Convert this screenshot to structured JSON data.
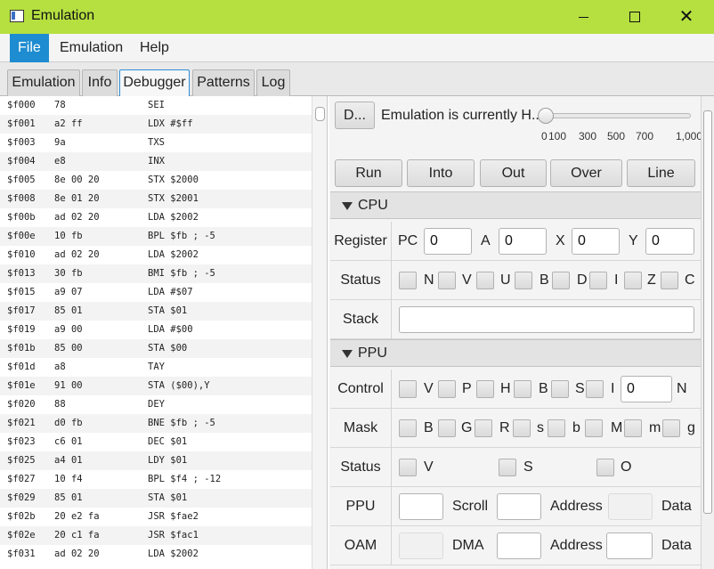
{
  "window": {
    "title": "Emulation"
  },
  "menu": {
    "items": [
      "File",
      "Emulation",
      "Help"
    ]
  },
  "tabs": [
    "Emulation",
    "Info",
    "Debugger",
    "Patterns",
    "Log"
  ],
  "disassembly": [
    {
      "addr": "$f000",
      "bytes": "78",
      "instr": "SEI"
    },
    {
      "addr": "$f001",
      "bytes": "a2 ff",
      "instr": "LDX #$ff"
    },
    {
      "addr": "$f003",
      "bytes": "9a",
      "instr": "TXS"
    },
    {
      "addr": "$f004",
      "bytes": "e8",
      "instr": "INX"
    },
    {
      "addr": "$f005",
      "bytes": "8e 00 20",
      "instr": "STX $2000"
    },
    {
      "addr": "$f008",
      "bytes": "8e 01 20",
      "instr": "STX $2001"
    },
    {
      "addr": "$f00b",
      "bytes": "ad 02 20",
      "instr": "LDA $2002"
    },
    {
      "addr": "$f00e",
      "bytes": "10 fb",
      "instr": "BPL $fb ; -5"
    },
    {
      "addr": "$f010",
      "bytes": "ad 02 20",
      "instr": "LDA $2002"
    },
    {
      "addr": "$f013",
      "bytes": "30 fb",
      "instr": "BMI $fb ; -5"
    },
    {
      "addr": "$f015",
      "bytes": "a9 07",
      "instr": "LDA #$07"
    },
    {
      "addr": "$f017",
      "bytes": "85 01",
      "instr": "STA $01"
    },
    {
      "addr": "$f019",
      "bytes": "a9 00",
      "instr": "LDA #$00"
    },
    {
      "addr": "$f01b",
      "bytes": "85 00",
      "instr": "STA $00"
    },
    {
      "addr": "$f01d",
      "bytes": "a8",
      "instr": "TAY"
    },
    {
      "addr": "$f01e",
      "bytes": "91 00",
      "instr": "STA ($00),Y"
    },
    {
      "addr": "$f020",
      "bytes": "88",
      "instr": "DEY"
    },
    {
      "addr": "$f021",
      "bytes": "d0 fb",
      "instr": "BNE $fb ; -5"
    },
    {
      "addr": "$f023",
      "bytes": "c6 01",
      "instr": "DEC $01"
    },
    {
      "addr": "$f025",
      "bytes": "a4 01",
      "instr": "LDY $01"
    },
    {
      "addr": "$f027",
      "bytes": "10 f4",
      "instr": "BPL $f4 ; -12"
    },
    {
      "addr": "$f029",
      "bytes": "85 01",
      "instr": "STA $01"
    },
    {
      "addr": "$f02b",
      "bytes": "20 e2 fa",
      "instr": "JSR $fae2"
    },
    {
      "addr": "$f02e",
      "bytes": "20 c1 fa",
      "instr": "JSR $fac1"
    },
    {
      "addr": "$f031",
      "bytes": "ad 02 20",
      "instr": "LDA $2002"
    }
  ],
  "debugger": {
    "toggle_label": "D...",
    "status": "Emulation is currently H...",
    "speed_slider": {
      "value": 0,
      "ticks": [
        "0",
        "100",
        "300",
        "500",
        "700",
        "1,000"
      ]
    },
    "step_buttons": [
      "Run",
      "Into",
      "Out",
      "Over",
      "Line"
    ]
  },
  "cpu": {
    "title": "CPU",
    "register_label": "Register",
    "registers": [
      {
        "name": "PC",
        "value": "0"
      },
      {
        "name": "A",
        "value": "0"
      },
      {
        "name": "X",
        "value": "0"
      },
      {
        "name": "Y",
        "value": "0"
      }
    ],
    "status_label": "Status",
    "flags": [
      "N",
      "V",
      "U",
      "B",
      "D",
      "I",
      "Z",
      "C"
    ],
    "stack_label": "Stack",
    "stack_value": ""
  },
  "ppu": {
    "title": "PPU",
    "control_label": "Control",
    "control_flags": [
      "V",
      "P",
      "H",
      "B",
      "S",
      "I"
    ],
    "control_value": "0",
    "control_suffix": "N",
    "mask_label": "Mask",
    "mask_flags": [
      "B",
      "G",
      "R",
      "s",
      "b",
      "M",
      "m",
      "g"
    ],
    "status_label": "Status",
    "status_flags": [
      "V",
      "S",
      "O"
    ],
    "ppu_row": {
      "label": "PPU",
      "scroll": "Scroll",
      "address": "Address",
      "data": "Data"
    },
    "oam_row": {
      "label": "OAM",
      "dma": "DMA",
      "address": "Address",
      "data": "Data"
    }
  }
}
